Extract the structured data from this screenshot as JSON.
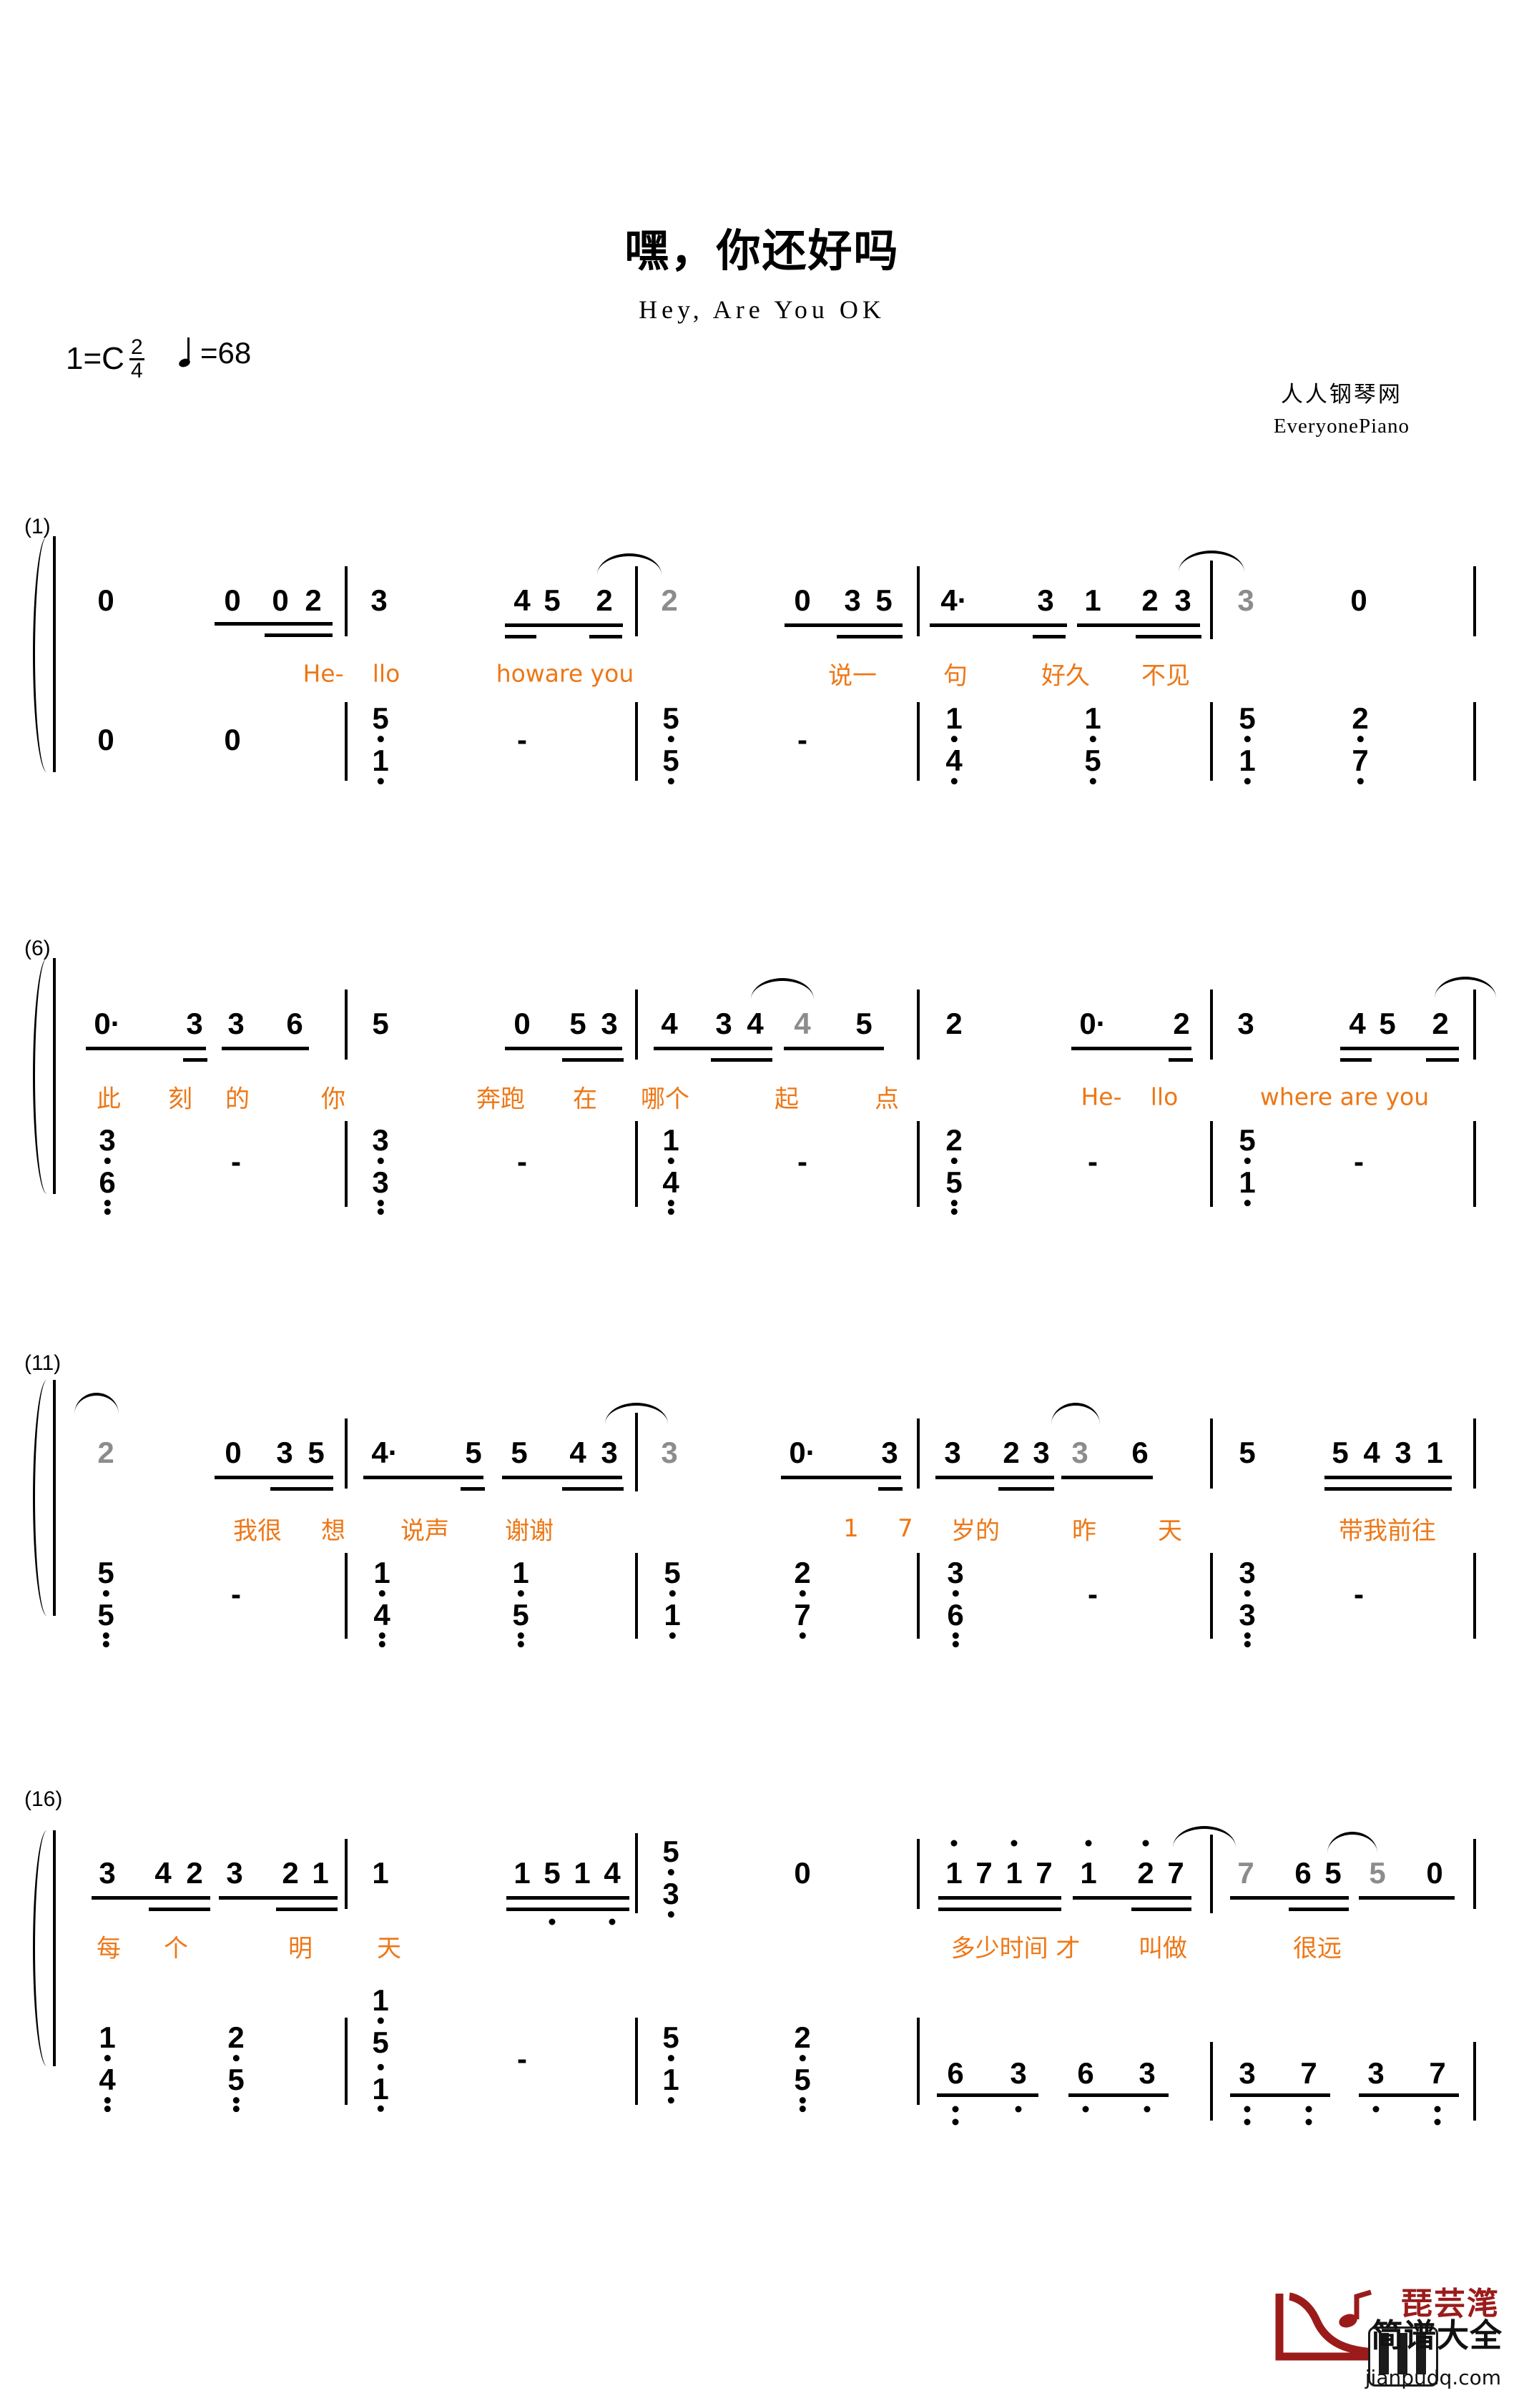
{
  "header": {
    "title": "嘿，你还好吗",
    "subtitle": "Hey, Are You OK",
    "key": "1=C",
    "time_num": "2",
    "time_den": "4",
    "tempo": "=68",
    "credit_cn": "人人钢琴网",
    "credit_en": "EveryonePiano"
  },
  "systems": [
    {
      "number": "(1)"
    },
    {
      "number": "(6)"
    },
    {
      "number": "(11)"
    },
    {
      "number": "(16)"
    }
  ],
  "lyrics": {
    "s1": [
      "He-",
      "llo",
      "howare you",
      "说一",
      "句",
      "好久",
      "不见"
    ],
    "s2": [
      "此",
      "刻",
      "的",
      "你",
      "奔跑",
      "在",
      "哪个",
      "起",
      "点",
      "He-",
      "llo",
      "where are you"
    ],
    "s3": [
      "我很",
      "想",
      "说声",
      "谢谢",
      "1",
      "7",
      "岁的",
      "昨",
      "天",
      "带我前往"
    ],
    "s4": [
      "每",
      "个",
      "明",
      "天",
      "多少时间 才",
      "叫做",
      "很远"
    ]
  },
  "melody": {
    "s1": [
      "0",
      "0",
      "0",
      "2",
      "3",
      "4",
      "5",
      "2",
      "2",
      "0",
      "3",
      "5",
      "4·",
      "3",
      "1",
      "2",
      "3",
      "3",
      "0"
    ],
    "s2": [
      "0·",
      "3",
      "3",
      "6",
      "5",
      "0",
      "5",
      "3",
      "4",
      "3",
      "4",
      "4",
      "5",
      "2",
      "0·",
      "2",
      "3",
      "4",
      "5",
      "2"
    ],
    "s3": [
      "2",
      "0",
      "3",
      "5",
      "4·",
      "5",
      "5",
      "4",
      "3",
      "3",
      "0·",
      "3",
      "3",
      "2",
      "3",
      "3",
      "6",
      "5",
      "5",
      "4",
      "3",
      "1"
    ],
    "s4": [
      "3",
      "4",
      "2",
      "3",
      "2",
      "1",
      "1",
      "1",
      "5",
      "1",
      "4",
      "5",
      "3",
      "0",
      "1",
      "7",
      "1",
      "7",
      "1",
      "2",
      "7",
      "7",
      "6",
      "5",
      "5",
      "0"
    ]
  },
  "bass": {
    "s1": [
      "0",
      "0",
      "5/1",
      "-",
      "5/5",
      "-",
      "1/4",
      "1/5",
      "5/1",
      "2/7"
    ],
    "s2": [
      "3/6",
      "-",
      "3/3",
      "-",
      "1/4",
      "-",
      "2/5",
      "-",
      "5/1",
      "-"
    ],
    "s3": [
      "5/5",
      "-",
      "1/4",
      "1/5",
      "5/1",
      "2/7",
      "3/6",
      "-",
      "3/3",
      "-"
    ],
    "s4": [
      "1/4",
      "2/5",
      "1/5/1",
      "-",
      "5/1",
      "2/5",
      "6",
      "3",
      "6",
      "3",
      "3",
      "7",
      "3",
      "7"
    ]
  },
  "footer": {
    "brand_red": "琵芸滗",
    "brand_cn": "简谱大全",
    "url": "jianpudq.com"
  },
  "colors": {
    "lyric": "#EE7716",
    "ghost_note": "#8c8c8c",
    "logo_red": "#9B1B1B"
  }
}
